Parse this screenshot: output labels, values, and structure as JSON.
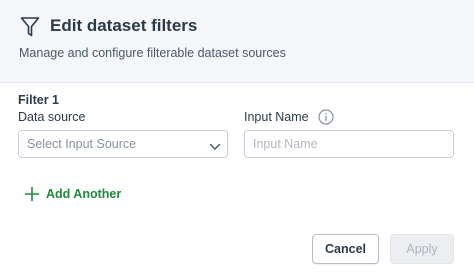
{
  "dialog": {
    "title": "Edit dataset filters",
    "subtitle": "Manage and configure filterable dataset sources",
    "title_icon": "filter-funnel-icon"
  },
  "filter": {
    "label": "Filter 1",
    "data_source_label": "Data source",
    "data_source_value": "Select Input Source",
    "input_name_label": "Input Name",
    "input_name_placeholder": "Input Name",
    "input_name_value": "",
    "info_icon": "info-icon",
    "chevron_icon": "chevron-down-icon"
  },
  "add_another": {
    "label": "Add Another",
    "icon": "plus-icon"
  },
  "footer": {
    "cancel_label": "Cancel",
    "apply_label": "Apply"
  },
  "colors": {
    "header_bg": "#f5f6fa",
    "accent_green": "#1e8a3c",
    "disabled_text": "#b0b6be"
  }
}
